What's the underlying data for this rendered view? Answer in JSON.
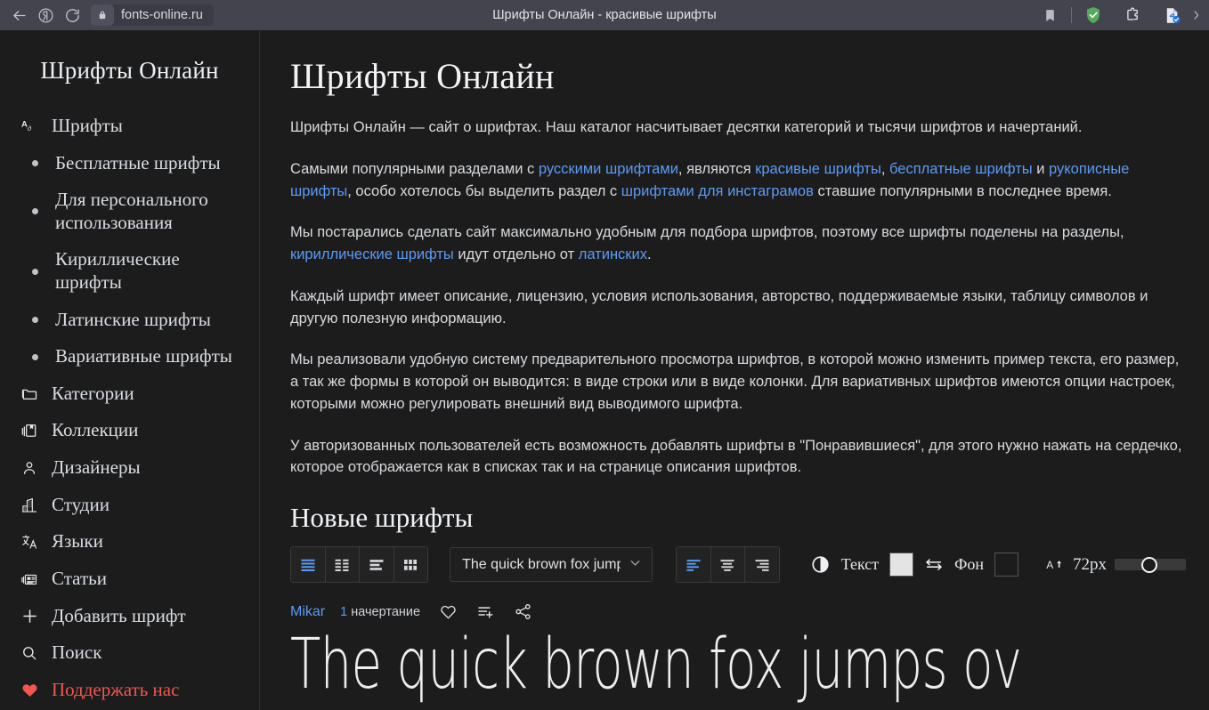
{
  "browser": {
    "back_icon": "back-arrow-icon",
    "yandex_icon": "yandex-logo-icon",
    "reload_icon": "reload-icon",
    "lock_icon": "lock-icon",
    "url": "fonts-online.ru",
    "title": "Шрифты Онлайн - красивые шрифты",
    "right_icons": [
      {
        "name": "bookmark-icon"
      },
      {
        "name": "adguard-shield-icon",
        "color": "#4caf50"
      },
      {
        "name": "extension-puzzle-icon"
      },
      {
        "name": "document-check-icon",
        "color": "#1a73e8"
      }
    ]
  },
  "sidebar": {
    "brand": "Шрифты Онлайн",
    "items": [
      {
        "label": "Шрифты",
        "icon": "font-aa-icon",
        "type": "main"
      },
      {
        "label": "Бесплатные шрифты",
        "icon": "bullet-dot-icon",
        "type": "sub"
      },
      {
        "label": "Для персонального использования",
        "icon": "bullet-dot-icon",
        "type": "sub"
      },
      {
        "label": "Кириллические шрифты",
        "icon": "bullet-dot-icon",
        "type": "sub"
      },
      {
        "label": "Латинские шрифты",
        "icon": "bullet-dot-icon",
        "type": "sub"
      },
      {
        "label": "Вариативные шрифты",
        "icon": "bullet-dot-icon",
        "type": "sub"
      },
      {
        "label": "Категории",
        "icon": "folder-icon",
        "type": "main"
      },
      {
        "label": "Коллекции",
        "icon": "collections-icon",
        "type": "main"
      },
      {
        "label": "Дизайнеры",
        "icon": "person-icon",
        "type": "main"
      },
      {
        "label": "Студии",
        "icon": "building-icon",
        "type": "main"
      },
      {
        "label": "Языки",
        "icon": "translate-icon",
        "type": "main"
      },
      {
        "label": "Статьи",
        "icon": "article-icon",
        "type": "main"
      },
      {
        "label": "Добавить шрифт",
        "icon": "plus-icon",
        "type": "main"
      },
      {
        "label": "Поиск",
        "icon": "search-icon",
        "type": "main"
      },
      {
        "label": "Поддержать нас",
        "icon": "heart-icon",
        "type": "support"
      }
    ]
  },
  "main": {
    "title": "Шрифты Онлайн",
    "paragraphs": {
      "p1": "Шрифты Онлайн — сайт о шрифтах. Наш каталог насчитывает десятки категорий и тысячи шрифтов и начертаний.",
      "p2_a": "Самыми популярными разделами с ",
      "p2_l1": "русскими шрифтами",
      "p2_b": ", являются ",
      "p2_l2": "красивые шрифты",
      "p2_c": ", ",
      "p2_l3": "бесплатные шрифты",
      "p2_d": " и ",
      "p2_l4": "рукописные шрифты",
      "p2_e": ", особо хотелось бы выделить раздел с ",
      "p2_l5": "шрифтами для инстаграмов",
      "p2_f": " ставшие популярными в последнее время.",
      "p3_a": "Мы постарались сделать сайт максимально удобным для подбора шрифтов, поэтому все шрифты поделены на разделы, ",
      "p3_l1": "кириллические шрифты",
      "p3_b": " идут отдельно от ",
      "p3_l2": "латинских",
      "p3_c": ".",
      "p4": "Каждый шрифт имеет описание, лицензию, условия использования, авторство, поддерживаемые языки, таблицу символов и другую полезную информацию.",
      "p5": "Мы реализовали удобную систему предварительного просмотра шрифтов, в которой можно изменить пример текста, его размер, а так же формы в которой он выводится: в виде строки или в виде колонки. Для вариативных шрифтов имеются опции настроек, которыми можно регулировать внешний вид выводимого шрифта.",
      "p6": "У авторизованных пользователей есть возможность добавлять шрифты в \"Понравившиеся\", для этого нужно нажать на сердечко, которое отображается как в списках так и на странице описания шрифтов."
    },
    "section_title": "Новые шрифты"
  },
  "toolbar": {
    "view_modes": [
      {
        "name": "view-rows-icon",
        "active": true
      },
      {
        "name": "view-two-column-icon",
        "active": false
      },
      {
        "name": "view-stack-icon",
        "active": false
      },
      {
        "name": "view-grid-icon",
        "active": false
      }
    ],
    "sample_select": {
      "value": "The quick brown fox jumps o",
      "chevron": "chevron-down-icon"
    },
    "align_modes": [
      {
        "name": "align-left-icon",
        "active": true
      },
      {
        "name": "align-center-icon",
        "active": false
      },
      {
        "name": "align-right-icon",
        "active": false
      }
    ],
    "contrast_icon": "contrast-icon",
    "text_label": "Текст",
    "text_color": "#e4e4e4",
    "swap_icon": "swap-arrows-icon",
    "bg_label": "Фон",
    "bg_color": "#1c1c1c",
    "size_icon": "font-size-up-icon",
    "size_value": "72px",
    "slider_percent": 45
  },
  "font_card": {
    "name": "Mikar",
    "styles_count": "1",
    "styles_word": "начертание",
    "like_icon": "heart-outline-icon",
    "add_list_icon": "add-to-list-icon",
    "share_icon": "share-icon",
    "preview_text": "The quick brown fox jumps ov"
  }
}
